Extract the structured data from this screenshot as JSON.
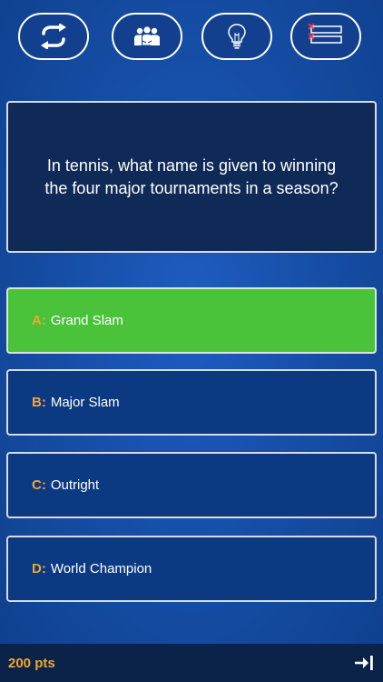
{
  "lifelines": [
    {
      "icon": "swap-icon"
    },
    {
      "icon": "audience-icon"
    },
    {
      "icon": "lightbulb-icon"
    },
    {
      "icon": "fifty-fifty-icon"
    }
  ],
  "question": {
    "text": "In tennis, what name is given to winning the four major tournaments in a season?"
  },
  "answers": [
    {
      "letter": "A:",
      "text": "Grand Slam",
      "state": "correct"
    },
    {
      "letter": "B:",
      "text": "Major Slam",
      "state": "default"
    },
    {
      "letter": "C:",
      "text": "Outright",
      "state": "default"
    },
    {
      "letter": "D:",
      "text": "World Champion",
      "state": "default"
    }
  ],
  "footer": {
    "score": "200 pts",
    "exit_icon": "exit-icon"
  },
  "colors": {
    "correct": "#4ac23a",
    "letter": "#f2a531",
    "panel": "#0f2a57",
    "answer_bg": "#0c3a82"
  }
}
